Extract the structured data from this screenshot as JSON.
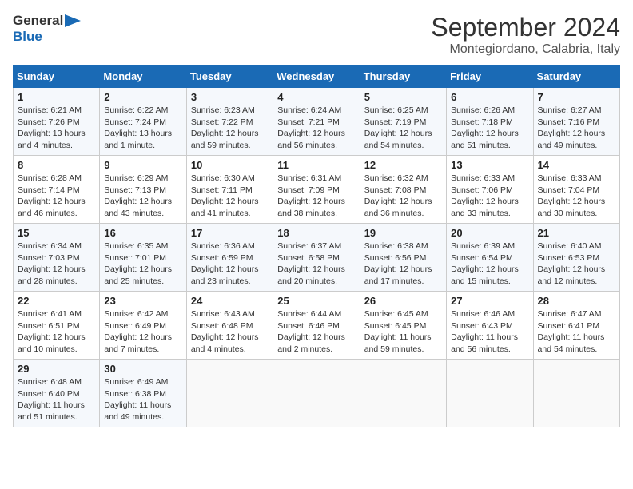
{
  "header": {
    "logo_line1": "General",
    "logo_line2": "Blue",
    "month": "September 2024",
    "location": "Montegiordano, Calabria, Italy"
  },
  "weekdays": [
    "Sunday",
    "Monday",
    "Tuesday",
    "Wednesday",
    "Thursday",
    "Friday",
    "Saturday"
  ],
  "weeks": [
    [
      {
        "day": "1",
        "sunrise": "6:21 AM",
        "sunset": "7:26 PM",
        "daylight": "13 hours and 4 minutes."
      },
      {
        "day": "2",
        "sunrise": "6:22 AM",
        "sunset": "7:24 PM",
        "daylight": "13 hours and 1 minute."
      },
      {
        "day": "3",
        "sunrise": "6:23 AM",
        "sunset": "7:22 PM",
        "daylight": "12 hours and 59 minutes."
      },
      {
        "day": "4",
        "sunrise": "6:24 AM",
        "sunset": "7:21 PM",
        "daylight": "12 hours and 56 minutes."
      },
      {
        "day": "5",
        "sunrise": "6:25 AM",
        "sunset": "7:19 PM",
        "daylight": "12 hours and 54 minutes."
      },
      {
        "day": "6",
        "sunrise": "6:26 AM",
        "sunset": "7:18 PM",
        "daylight": "12 hours and 51 minutes."
      },
      {
        "day": "7",
        "sunrise": "6:27 AM",
        "sunset": "7:16 PM",
        "daylight": "12 hours and 49 minutes."
      }
    ],
    [
      {
        "day": "8",
        "sunrise": "6:28 AM",
        "sunset": "7:14 PM",
        "daylight": "12 hours and 46 minutes."
      },
      {
        "day": "9",
        "sunrise": "6:29 AM",
        "sunset": "7:13 PM",
        "daylight": "12 hours and 43 minutes."
      },
      {
        "day": "10",
        "sunrise": "6:30 AM",
        "sunset": "7:11 PM",
        "daylight": "12 hours and 41 minutes."
      },
      {
        "day": "11",
        "sunrise": "6:31 AM",
        "sunset": "7:09 PM",
        "daylight": "12 hours and 38 minutes."
      },
      {
        "day": "12",
        "sunrise": "6:32 AM",
        "sunset": "7:08 PM",
        "daylight": "12 hours and 36 minutes."
      },
      {
        "day": "13",
        "sunrise": "6:33 AM",
        "sunset": "7:06 PM",
        "daylight": "12 hours and 33 minutes."
      },
      {
        "day": "14",
        "sunrise": "6:33 AM",
        "sunset": "7:04 PM",
        "daylight": "12 hours and 30 minutes."
      }
    ],
    [
      {
        "day": "15",
        "sunrise": "6:34 AM",
        "sunset": "7:03 PM",
        "daylight": "12 hours and 28 minutes."
      },
      {
        "day": "16",
        "sunrise": "6:35 AM",
        "sunset": "7:01 PM",
        "daylight": "12 hours and 25 minutes."
      },
      {
        "day": "17",
        "sunrise": "6:36 AM",
        "sunset": "6:59 PM",
        "daylight": "12 hours and 23 minutes."
      },
      {
        "day": "18",
        "sunrise": "6:37 AM",
        "sunset": "6:58 PM",
        "daylight": "12 hours and 20 minutes."
      },
      {
        "day": "19",
        "sunrise": "6:38 AM",
        "sunset": "6:56 PM",
        "daylight": "12 hours and 17 minutes."
      },
      {
        "day": "20",
        "sunrise": "6:39 AM",
        "sunset": "6:54 PM",
        "daylight": "12 hours and 15 minutes."
      },
      {
        "day": "21",
        "sunrise": "6:40 AM",
        "sunset": "6:53 PM",
        "daylight": "12 hours and 12 minutes."
      }
    ],
    [
      {
        "day": "22",
        "sunrise": "6:41 AM",
        "sunset": "6:51 PM",
        "daylight": "12 hours and 10 minutes."
      },
      {
        "day": "23",
        "sunrise": "6:42 AM",
        "sunset": "6:49 PM",
        "daylight": "12 hours and 7 minutes."
      },
      {
        "day": "24",
        "sunrise": "6:43 AM",
        "sunset": "6:48 PM",
        "daylight": "12 hours and 4 minutes."
      },
      {
        "day": "25",
        "sunrise": "6:44 AM",
        "sunset": "6:46 PM",
        "daylight": "12 hours and 2 minutes."
      },
      {
        "day": "26",
        "sunrise": "6:45 AM",
        "sunset": "6:45 PM",
        "daylight": "11 hours and 59 minutes."
      },
      {
        "day": "27",
        "sunrise": "6:46 AM",
        "sunset": "6:43 PM",
        "daylight": "11 hours and 56 minutes."
      },
      {
        "day": "28",
        "sunrise": "6:47 AM",
        "sunset": "6:41 PM",
        "daylight": "11 hours and 54 minutes."
      }
    ],
    [
      {
        "day": "29",
        "sunrise": "6:48 AM",
        "sunset": "6:40 PM",
        "daylight": "11 hours and 51 minutes."
      },
      {
        "day": "30",
        "sunrise": "6:49 AM",
        "sunset": "6:38 PM",
        "daylight": "11 hours and 49 minutes."
      },
      null,
      null,
      null,
      null,
      null
    ]
  ]
}
